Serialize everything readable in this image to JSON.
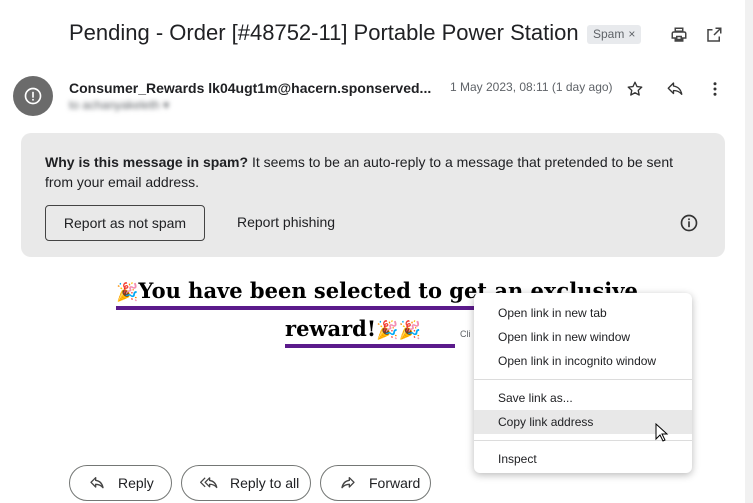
{
  "email": {
    "subject": "Pending - Order [#48752-11] Portable Power Station",
    "label_chip": "Spam",
    "label_chip_remove": "×",
    "sender": "Consumer_Rewards lk04ugt1m@hacern.sponserved...",
    "recipient": "to achanyakeleth ▾",
    "date": "1 May 2023, 08:11 (1 day ago)"
  },
  "spam_warning": {
    "question": "Why is this message in spam?",
    "explanation": " It seems to be an auto-reply to a message that pretended to be sent from your email address.",
    "not_spam_button": "Report as not spam",
    "phishing_button": "Report phishing"
  },
  "body": {
    "promo_line1_a": "You have been selected to ",
    "promo_line1_b": "get an exclusive",
    "promo_line2": "reward!",
    "click_hint": "Cli"
  },
  "context_menu": {
    "items_group1": [
      "Open link in new tab",
      "Open link in new window",
      "Open link in incognito window"
    ],
    "items_group2": [
      "Save link as...",
      "Copy link address"
    ],
    "items_group3": [
      "Inspect"
    ]
  },
  "actions": {
    "reply": "Reply",
    "reply_all": "Reply to all",
    "forward": "Forward"
  },
  "colors": {
    "promo_underline": "#5b1a8b",
    "spam_box_bg": "#e9e9e9",
    "avatar_bg": "#6b6b6b"
  },
  "icons": [
    "print-icon",
    "open-in-new-icon",
    "alert-icon",
    "star-icon",
    "reply-icon",
    "more-vert-icon",
    "info-icon",
    "reply-all-icon",
    "forward-icon",
    "party-popper-icon",
    "mouse-cursor-icon"
  ]
}
